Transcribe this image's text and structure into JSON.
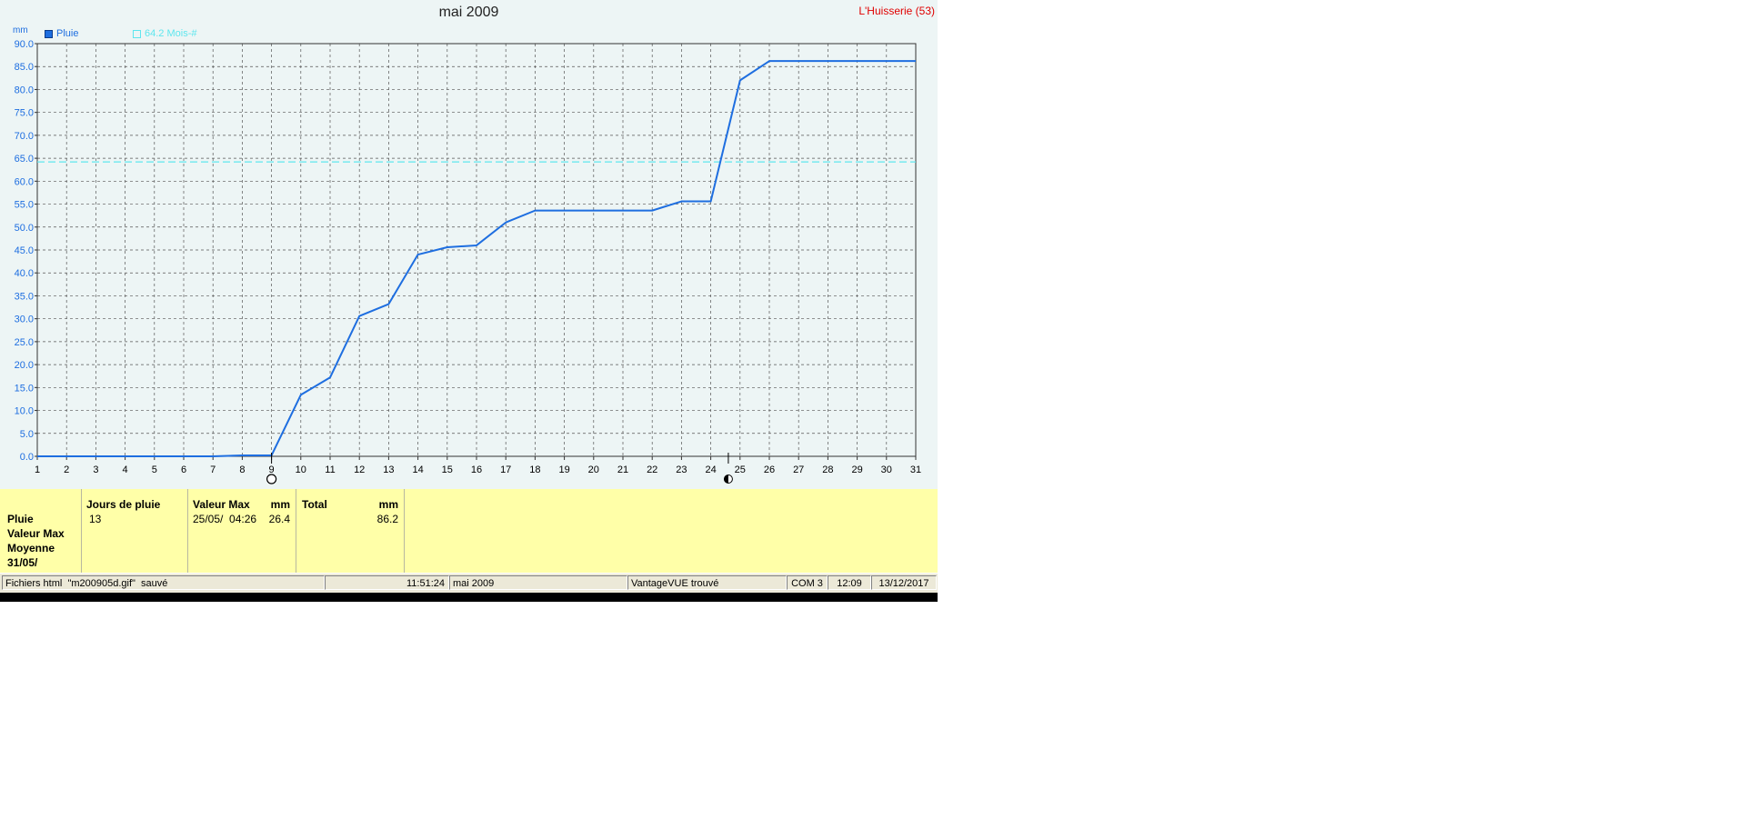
{
  "chart": {
    "title": "mai 2009",
    "station": "L'Huisserie (53)",
    "unit": "mm",
    "legend": {
      "series_label": "Pluie",
      "reference_label": "64.2 Mois-#"
    }
  },
  "chart_data": {
    "type": "line",
    "title": "mai 2009",
    "xlabel": "",
    "ylabel": "mm",
    "xlim": [
      1,
      31
    ],
    "ylim": [
      0,
      90
    ],
    "y_tick_step": 5,
    "x": [
      1,
      2,
      3,
      4,
      5,
      6,
      7,
      8,
      9,
      10,
      11,
      12,
      13,
      14,
      15,
      16,
      17,
      18,
      19,
      20,
      21,
      22,
      23,
      24,
      25,
      26,
      27,
      28,
      29,
      30,
      31
    ],
    "series": [
      {
        "name": "Pluie",
        "color": "#1e6ee0",
        "values": [
          0,
          0,
          0,
          0,
          0,
          0,
          0,
          0.2,
          0.2,
          13.4,
          17.2,
          30.6,
          33.2,
          44.0,
          45.6,
          46.0,
          51.0,
          53.6,
          53.6,
          53.6,
          53.6,
          53.6,
          55.6,
          55.6,
          82.0,
          86.2,
          86.2,
          86.2,
          86.2,
          86.2,
          86.2
        ]
      }
    ],
    "reference_lines": [
      {
        "name": "64.2 Mois-#",
        "value": 64.2,
        "color": "#5ee6ee",
        "style": "dashed"
      }
    ],
    "moon_markers": [
      {
        "x": 9,
        "phase": "new-moon"
      },
      {
        "x": 24.6,
        "phase": "first-quarter"
      }
    ],
    "grid": true,
    "legend_position": "top-left"
  },
  "stats": {
    "row_labels": [
      "Pluie",
      "Valeur Max",
      "Moyenne",
      "31/05/"
    ],
    "jours": {
      "header": "Jours de pluie",
      "value": "13"
    },
    "valeur_max": {
      "header": "Valeur Max",
      "unit": "mm",
      "date": "25/05/  04:26",
      "value": "26.4"
    },
    "total": {
      "header": "Total",
      "unit": "mm",
      "value": "86.2"
    }
  },
  "statusbar": {
    "file_msg": "Fichiers html  \"m200905d.gif\"  sauvé",
    "file_time": "11:51:24",
    "month": "mai 2009",
    "device": "VantageVUE trouvé",
    "port": "COM 3",
    "clock": "12:09",
    "date": "13/12/2017"
  }
}
